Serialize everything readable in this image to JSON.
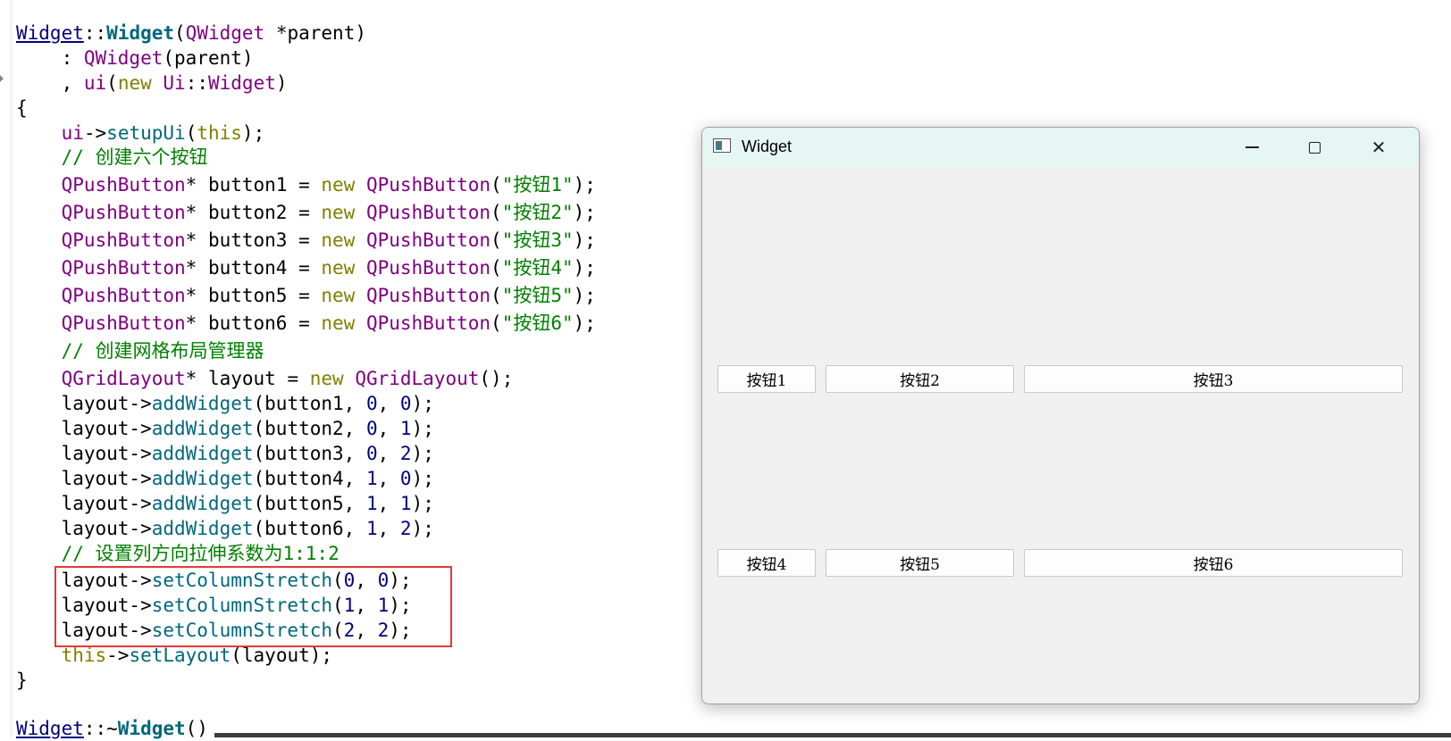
{
  "code": {
    "lines": [
      [
        {
          "t": "Widget",
          "c": "cls-def"
        },
        {
          "t": "::",
          "c": ""
        },
        {
          "t": "Widget",
          "c": "cls-bold"
        },
        {
          "t": "(",
          "c": ""
        },
        {
          "t": "QWidget",
          "c": "ty"
        },
        {
          "t": " *parent)",
          "c": ""
        }
      ],
      [
        {
          "t": "    : ",
          "c": ""
        },
        {
          "t": "QWidget",
          "c": "ty"
        },
        {
          "t": "(parent)",
          "c": ""
        }
      ],
      [
        {
          "t": "    , ",
          "c": ""
        },
        {
          "t": "ui",
          "c": "ty"
        },
        {
          "t": "(",
          "c": ""
        },
        {
          "t": "new",
          "c": "kw"
        },
        {
          "t": " ",
          "c": ""
        },
        {
          "t": "Ui",
          "c": "ty"
        },
        {
          "t": "::",
          "c": ""
        },
        {
          "t": "Widget",
          "c": "ty"
        },
        {
          "t": ")",
          "c": ""
        }
      ],
      [
        {
          "t": "{",
          "c": ""
        }
      ],
      [
        {
          "t": "    ",
          "c": ""
        },
        {
          "t": "ui",
          "c": "ty"
        },
        {
          "t": "->",
          "c": ""
        },
        {
          "t": "setupUi",
          "c": "fn"
        },
        {
          "t": "(",
          "c": ""
        },
        {
          "t": "this",
          "c": "kw"
        },
        {
          "t": ");",
          "c": ""
        }
      ],
      [
        {
          "t": "    // 创建六个按钮",
          "c": "cm"
        }
      ],
      [
        {
          "t": "    ",
          "c": ""
        },
        {
          "t": "QPushButton",
          "c": "ty"
        },
        {
          "t": "* button1 = ",
          "c": ""
        },
        {
          "t": "new",
          "c": "kw"
        },
        {
          "t": " ",
          "c": ""
        },
        {
          "t": "QPushButton",
          "c": "ty"
        },
        {
          "t": "(",
          "c": ""
        },
        {
          "t": "\"按钮1\"",
          "c": "str"
        },
        {
          "t": ");",
          "c": ""
        }
      ],
      [
        {
          "t": "    ",
          "c": ""
        },
        {
          "t": "QPushButton",
          "c": "ty"
        },
        {
          "t": "* button2 = ",
          "c": ""
        },
        {
          "t": "new",
          "c": "kw"
        },
        {
          "t": " ",
          "c": ""
        },
        {
          "t": "QPushButton",
          "c": "ty"
        },
        {
          "t": "(",
          "c": ""
        },
        {
          "t": "\"按钮2\"",
          "c": "str"
        },
        {
          "t": ");",
          "c": ""
        }
      ],
      [
        {
          "t": "    ",
          "c": ""
        },
        {
          "t": "QPushButton",
          "c": "ty"
        },
        {
          "t": "* button3 = ",
          "c": ""
        },
        {
          "t": "new",
          "c": "kw"
        },
        {
          "t": " ",
          "c": ""
        },
        {
          "t": "QPushButton",
          "c": "ty"
        },
        {
          "t": "(",
          "c": ""
        },
        {
          "t": "\"按钮3\"",
          "c": "str"
        },
        {
          "t": ");",
          "c": ""
        }
      ],
      [
        {
          "t": "    ",
          "c": ""
        },
        {
          "t": "QPushButton",
          "c": "ty"
        },
        {
          "t": "* button4 = ",
          "c": ""
        },
        {
          "t": "new",
          "c": "kw"
        },
        {
          "t": " ",
          "c": ""
        },
        {
          "t": "QPushButton",
          "c": "ty"
        },
        {
          "t": "(",
          "c": ""
        },
        {
          "t": "\"按钮4\"",
          "c": "str"
        },
        {
          "t": ");",
          "c": ""
        }
      ],
      [
        {
          "t": "    ",
          "c": ""
        },
        {
          "t": "QPushButton",
          "c": "ty"
        },
        {
          "t": "* button5 = ",
          "c": ""
        },
        {
          "t": "new",
          "c": "kw"
        },
        {
          "t": " ",
          "c": ""
        },
        {
          "t": "QPushButton",
          "c": "ty"
        },
        {
          "t": "(",
          "c": ""
        },
        {
          "t": "\"按钮5\"",
          "c": "str"
        },
        {
          "t": ");",
          "c": ""
        }
      ],
      [
        {
          "t": "    ",
          "c": ""
        },
        {
          "t": "QPushButton",
          "c": "ty"
        },
        {
          "t": "* button6 = ",
          "c": ""
        },
        {
          "t": "new",
          "c": "kw"
        },
        {
          "t": " ",
          "c": ""
        },
        {
          "t": "QPushButton",
          "c": "ty"
        },
        {
          "t": "(",
          "c": ""
        },
        {
          "t": "\"按钮6\"",
          "c": "str"
        },
        {
          "t": ");",
          "c": ""
        }
      ],
      [
        {
          "t": "    // 创建网格布局管理器",
          "c": "cm"
        }
      ],
      [
        {
          "t": "    ",
          "c": ""
        },
        {
          "t": "QGridLayout",
          "c": "ty"
        },
        {
          "t": "* layout = ",
          "c": ""
        },
        {
          "t": "new",
          "c": "kw"
        },
        {
          "t": " ",
          "c": ""
        },
        {
          "t": "QGridLayout",
          "c": "ty"
        },
        {
          "t": "();",
          "c": ""
        }
      ],
      [
        {
          "t": "    layout->",
          "c": ""
        },
        {
          "t": "addWidget",
          "c": "fn"
        },
        {
          "t": "(button1, ",
          "c": ""
        },
        {
          "t": "0",
          "c": "num"
        },
        {
          "t": ", ",
          "c": ""
        },
        {
          "t": "0",
          "c": "num"
        },
        {
          "t": ");",
          "c": ""
        }
      ],
      [
        {
          "t": "    layout->",
          "c": ""
        },
        {
          "t": "addWidget",
          "c": "fn"
        },
        {
          "t": "(button2, ",
          "c": ""
        },
        {
          "t": "0",
          "c": "num"
        },
        {
          "t": ", ",
          "c": ""
        },
        {
          "t": "1",
          "c": "num"
        },
        {
          "t": ");",
          "c": ""
        }
      ],
      [
        {
          "t": "    layout->",
          "c": ""
        },
        {
          "t": "addWidget",
          "c": "fn"
        },
        {
          "t": "(button3, ",
          "c": ""
        },
        {
          "t": "0",
          "c": "num"
        },
        {
          "t": ", ",
          "c": ""
        },
        {
          "t": "2",
          "c": "num"
        },
        {
          "t": ");",
          "c": ""
        }
      ],
      [
        {
          "t": "    layout->",
          "c": ""
        },
        {
          "t": "addWidget",
          "c": "fn"
        },
        {
          "t": "(button4, ",
          "c": ""
        },
        {
          "t": "1",
          "c": "num"
        },
        {
          "t": ", ",
          "c": ""
        },
        {
          "t": "0",
          "c": "num"
        },
        {
          "t": ");",
          "c": ""
        }
      ],
      [
        {
          "t": "    layout->",
          "c": ""
        },
        {
          "t": "addWidget",
          "c": "fn"
        },
        {
          "t": "(button5, ",
          "c": ""
        },
        {
          "t": "1",
          "c": "num"
        },
        {
          "t": ", ",
          "c": ""
        },
        {
          "t": "1",
          "c": "num"
        },
        {
          "t": ");",
          "c": ""
        }
      ],
      [
        {
          "t": "    layout->",
          "c": ""
        },
        {
          "t": "addWidget",
          "c": "fn"
        },
        {
          "t": "(button6, ",
          "c": ""
        },
        {
          "t": "1",
          "c": "num"
        },
        {
          "t": ", ",
          "c": ""
        },
        {
          "t": "2",
          "c": "num"
        },
        {
          "t": ");",
          "c": ""
        }
      ],
      [
        {
          "t": "    // 设置列方向拉伸系数为1:1:2",
          "c": "cm"
        }
      ],
      [
        {
          "t": "    layout->",
          "c": ""
        },
        {
          "t": "setColumnStretch",
          "c": "fn"
        },
        {
          "t": "(",
          "c": ""
        },
        {
          "t": "0",
          "c": "num"
        },
        {
          "t": ", ",
          "c": ""
        },
        {
          "t": "0",
          "c": "num"
        },
        {
          "t": ");",
          "c": ""
        }
      ],
      [
        {
          "t": "    layout->",
          "c": ""
        },
        {
          "t": "setColumnStretch",
          "c": "fn"
        },
        {
          "t": "(",
          "c": ""
        },
        {
          "t": "1",
          "c": "num"
        },
        {
          "t": ", ",
          "c": ""
        },
        {
          "t": "1",
          "c": "num"
        },
        {
          "t": ");",
          "c": ""
        }
      ],
      [
        {
          "t": "    layout->",
          "c": ""
        },
        {
          "t": "setColumnStretch",
          "c": "fn"
        },
        {
          "t": "(",
          "c": ""
        },
        {
          "t": "2",
          "c": "num"
        },
        {
          "t": ", ",
          "c": ""
        },
        {
          "t": "2",
          "c": "num"
        },
        {
          "t": ");",
          "c": ""
        }
      ],
      [
        {
          "t": "    ",
          "c": ""
        },
        {
          "t": "this",
          "c": "kw"
        },
        {
          "t": "->",
          "c": ""
        },
        {
          "t": "setLayout",
          "c": "fn"
        },
        {
          "t": "(layout);",
          "c": ""
        }
      ],
      [
        {
          "t": "}",
          "c": ""
        }
      ],
      [
        {
          "t": "",
          "c": ""
        }
      ],
      [
        {
          "t": "Widget",
          "c": "cls-def"
        },
        {
          "t": "::~",
          "c": ""
        },
        {
          "t": "Widget",
          "c": "cls-bold"
        },
        {
          "t": "()",
          "c": ""
        }
      ]
    ]
  },
  "window": {
    "title": "Widget",
    "icon": "app-window-icon",
    "controls": [
      "minimize-icon",
      "maximize-icon",
      "close-icon"
    ],
    "close_glyph": "✕",
    "buttons": [
      {
        "label": "按钮1"
      },
      {
        "label": "按钮2"
      },
      {
        "label": "按钮3"
      },
      {
        "label": "按钮4"
      },
      {
        "label": "按钮5"
      },
      {
        "label": "按钮6"
      }
    ]
  },
  "colors": {
    "keyword": "#808000",
    "type": "#800080",
    "function": "#00677c",
    "number": "#000080",
    "string_comment": "#008000",
    "highlight_border": "#e53935",
    "titlebar": "#e6f6f2"
  }
}
